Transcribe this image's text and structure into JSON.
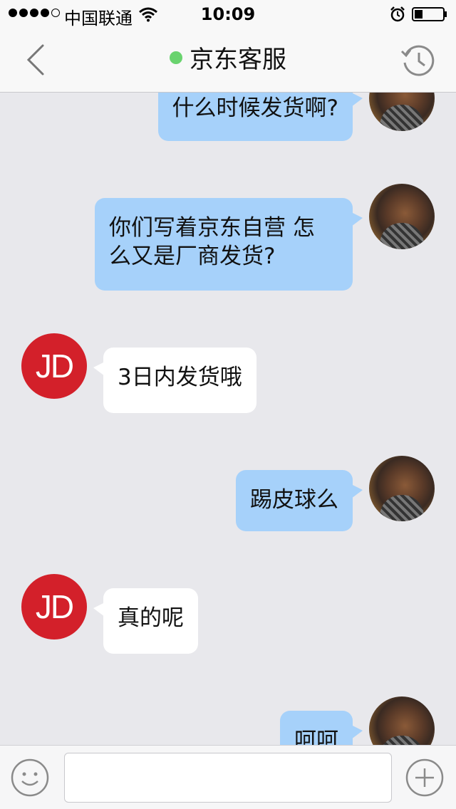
{
  "status_bar": {
    "carrier": "中国联通",
    "time": "10:09",
    "signal_bars_filled": 4,
    "signal_bars_total": 5,
    "battery_level": 0.3
  },
  "header": {
    "title": "京东客服",
    "online_color": "#69d36e",
    "back_icon": "chevron-left-icon",
    "history_icon": "history-clock-icon"
  },
  "messages": [
    {
      "sender": "user",
      "text": "什么时候发货啊?"
    },
    {
      "sender": "user",
      "text": "你们写着京东自营 怎\n么又是厂商发货?"
    },
    {
      "sender": "agent",
      "text": "3日内发货哦"
    },
    {
      "sender": "user",
      "text": "踢皮球么"
    },
    {
      "sender": "agent",
      "text": "真的呢"
    },
    {
      "sender": "user",
      "text": "呵呵"
    }
  ],
  "agent_avatar_label": "JD",
  "input_bar": {
    "placeholder": "",
    "emoji_icon": "smiley-icon",
    "plus_icon": "plus-circle-icon"
  },
  "colors": {
    "outgoing_bubble": "#a6d1fa",
    "incoming_bubble": "#ffffff",
    "background": "#e8e8ec",
    "jd_red": "#d3202a"
  }
}
